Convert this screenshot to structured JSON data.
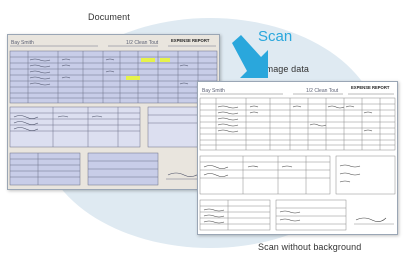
{
  "labels": {
    "document": "Document",
    "scan": "Scan",
    "image_data": "Image data",
    "scan_without_background": "Scan without background"
  },
  "document_header": {
    "title": "EXPENSE REPORT"
  },
  "colors": {
    "accent": "#2aa7dc",
    "background_ellipse": "#dfeaf2",
    "paper_tint": "#e9e5de",
    "table_fill": "#c8cde8",
    "highlight": "#e6f24a",
    "handwriting": "#5a5f73"
  },
  "icons": {
    "arrow": "arrow-down-right-icon"
  }
}
